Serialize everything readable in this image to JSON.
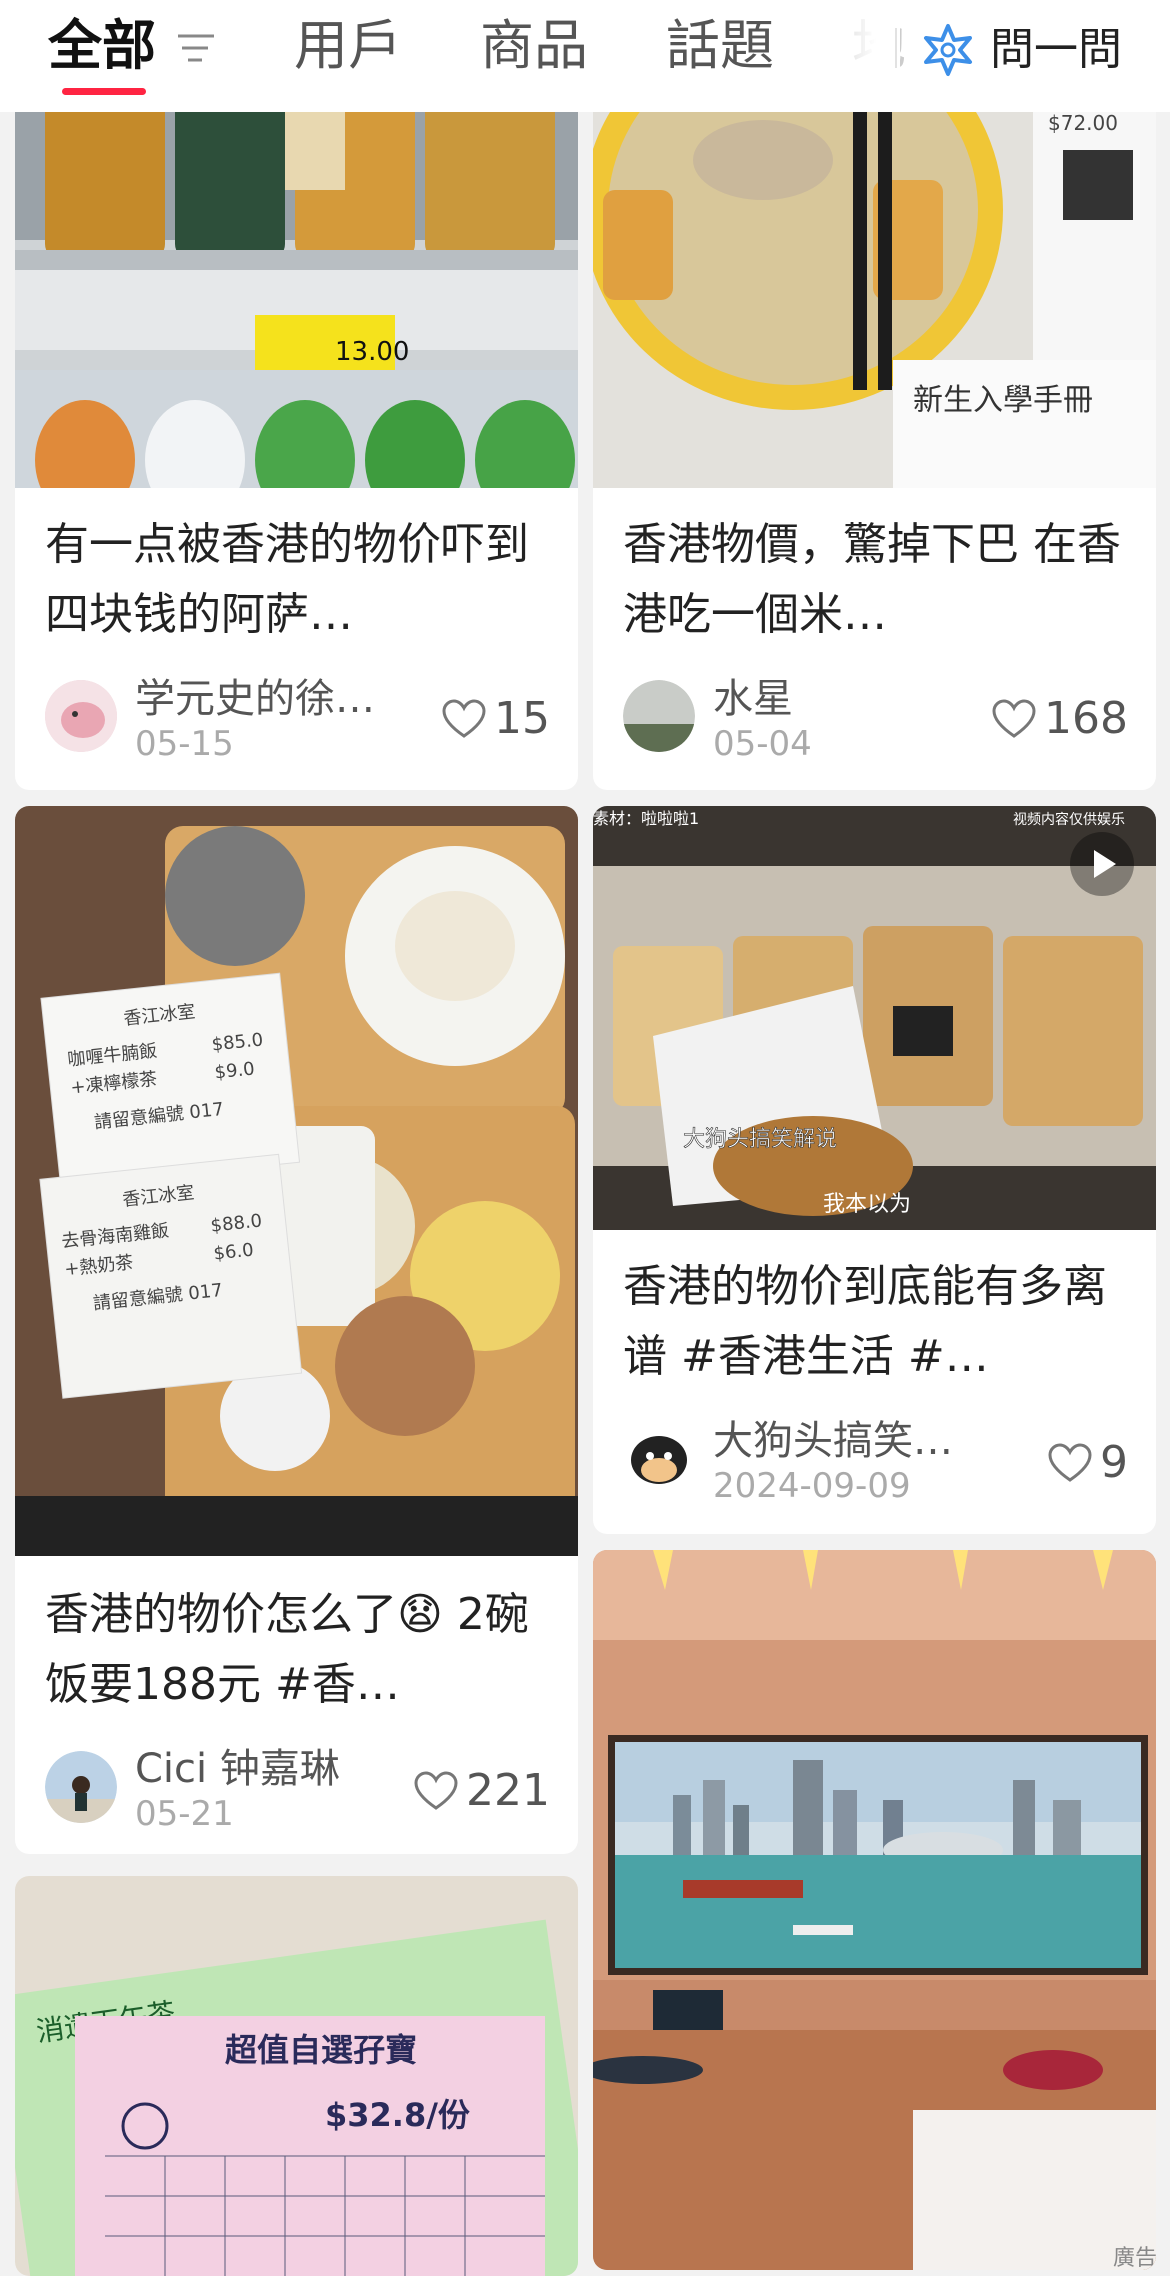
{
  "tabs": [
    {
      "label": "全部"
    },
    {
      "label": "用戶"
    },
    {
      "label": "商品"
    },
    {
      "label": "話題"
    },
    {
      "label": "地"
    }
  ],
  "ask": {
    "label": "問一問"
  },
  "posts": [
    {
      "title": "有一点被香港的物价吓到 四块钱的阿萨…",
      "author": "学元史的徐…",
      "date": "05-15",
      "likes": "15",
      "image": "drink-fridge-photo",
      "price_tag": "13.00"
    },
    {
      "title": "香港物價，驚掉下巴 在香港吃一個米…",
      "author": "水星",
      "date": "05-04",
      "likes": "168",
      "image": "noodle-soup-photo",
      "receipt_price": "$72.00",
      "booklet_text": "新生入學手冊"
    },
    {
      "title": "香港的物价怎么了😧 2碗饭要188元 #香…",
      "author": "Cici 钟嘉琳",
      "date": "05-21",
      "likes": "221",
      "image": "meal-receipt-photo",
      "receipt_a": {
        "shop": "香江冰室",
        "item1": "咖喱牛腩飯",
        "price1": "$85.0",
        "item2": "+凍檸檬茶",
        "price2": "$9.0",
        "note": "請留意編號 017"
      },
      "receipt_b": {
        "shop": "香江冰室",
        "item1": "去骨海南雞飯",
        "price1": "$88.0",
        "item2": "+熱奶茶",
        "price2": "$6.0",
        "note": "請留意編號 017"
      }
    },
    {
      "title": "香港的物价到底能有多离谱 #香港生活 #…",
      "author": "大狗头搞笑…",
      "date": "2024-09-09",
      "likes": "9",
      "image": "bread-shelf-video",
      "overlay_tl": "素材：啦啦啦1",
      "overlay_tr": "视频内容仅供娱乐",
      "caption1": "大狗头搞笑解说",
      "caption2": "我本以为"
    },
    {
      "title": "",
      "author": "",
      "date": "",
      "likes": "",
      "image": "tea-menu-photo",
      "menu_title": "超值自選孖寶",
      "menu_price": "$32.8/份",
      "menu_sub": "消遣下午茶"
    },
    {
      "title": "",
      "author": "",
      "date": "",
      "likes": "",
      "image": "hotel-harbour-view-photo",
      "corner": "廣告"
    }
  ],
  "colors": {
    "accent": "#ff2442",
    "background": "#f2f2f2",
    "card": "#ffffff"
  }
}
